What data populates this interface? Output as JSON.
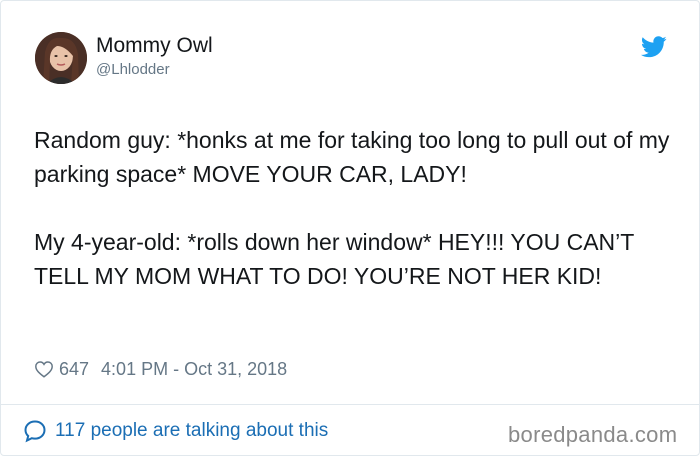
{
  "author": {
    "name": "Mommy Owl",
    "handle": "@Lhlodder"
  },
  "tweet": {
    "paragraphs": [
      "Random guy: *honks at me for taking too long to pull out of my parking space* MOVE YOUR CAR, LADY!",
      "My 4-year-old: *rolls down her window* HEY!!! YOU CAN’T TELL MY MOM WHAT TO DO! YOU’RE NOT HER KID!"
    ]
  },
  "meta": {
    "likes": "647",
    "timestamp": "4:01 PM - Oct 31, 2018"
  },
  "footer": {
    "talking": "117 people are talking about this"
  },
  "watermark": "boredpanda.com",
  "icons": {
    "brand": "twitter-bird-icon",
    "like": "heart-icon",
    "reply": "speech-bubble-icon"
  },
  "colors": {
    "twitter_blue": "#1da1f2",
    "link_blue": "#1b6eb4",
    "secondary_text": "#657786",
    "border": "#e1e8ed"
  }
}
